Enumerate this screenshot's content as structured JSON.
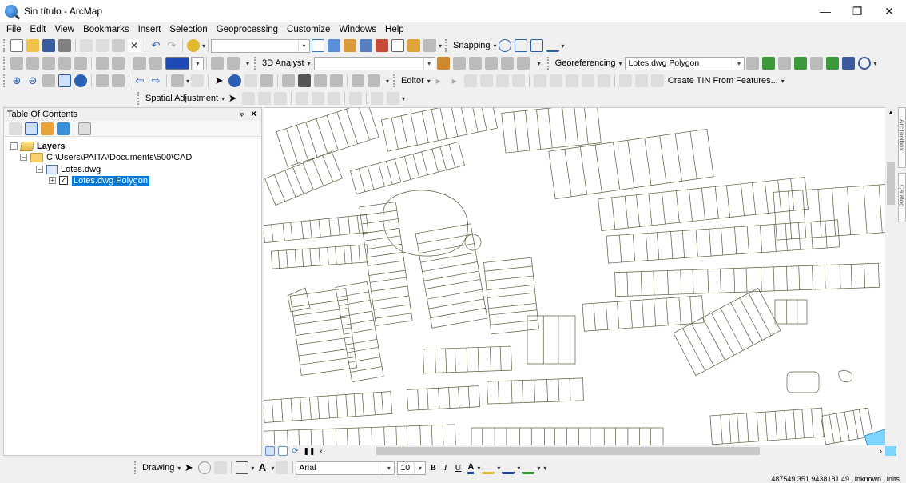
{
  "window": {
    "title": "Sin título - ArcMap",
    "minimize": "—",
    "maximize": "❐",
    "close": "✕"
  },
  "menu": [
    "File",
    "Edit",
    "View",
    "Bookmarks",
    "Insert",
    "Selection",
    "Geoprocessing",
    "Customize",
    "Windows",
    "Help"
  ],
  "toolbars": {
    "snapping_label": "Snapping",
    "analyst_label": "3D Analyst",
    "georeferencing_label": "Georeferencing",
    "georef_layer": "Lotes.dwg Polygon",
    "editor_label": "Editor",
    "create_tin_label": "Create TIN From Features...",
    "spatial_adjustment_label": "Spatial Adjustment",
    "drawing_label": "Drawing",
    "font_name": "Arial",
    "font_size": "10",
    "bold": "B",
    "italic": "I",
    "underline": "U",
    "font_color_label": "A"
  },
  "toc": {
    "title": "Table Of Contents",
    "pin": "ᵩ",
    "close": "×",
    "layers_label": "Layers",
    "folder_path": "C:\\Users\\PAITA\\Documents\\500\\CAD",
    "dataset": "Lotes.dwg",
    "layer": "Lotes.dwg Polygon"
  },
  "side_tabs": [
    "ArcToolbox",
    "Catalog"
  ],
  "status": {
    "coordinates": "487549.351  9438181.49 Unknown Units"
  },
  "colors": {
    "map_line": "#5a5a3c",
    "selection": "#0078d7",
    "background": "#f0f0f0"
  }
}
